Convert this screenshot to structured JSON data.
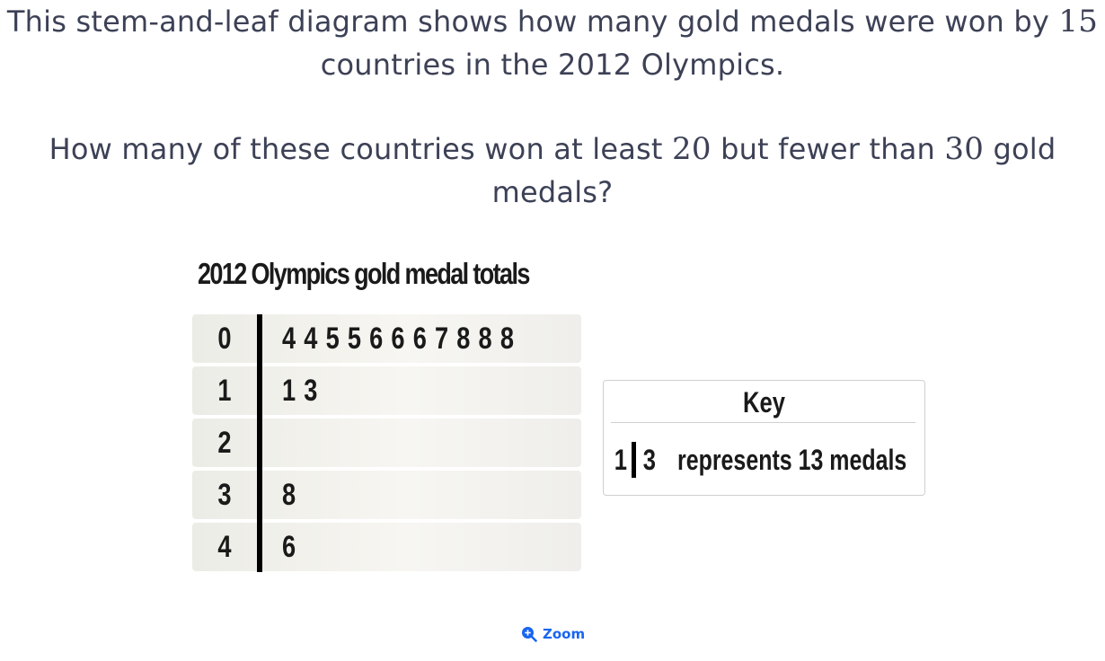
{
  "question": {
    "line1": {
      "before": "This stem-and-leaf diagram shows how many gold medals were won by",
      "num": "15",
      "after": "countries in the 2012 Olympics."
    },
    "line2": {
      "before": "How many of these countries won at least",
      "num1": "20",
      "middle": "but fewer than",
      "num2": "30",
      "after": "gold medals?"
    }
  },
  "plot": {
    "title": "2012 Olympics gold medal totals",
    "rows": [
      {
        "stem": "0",
        "leaves": "4 4 5 5 6 6 6 7 8 8 8"
      },
      {
        "stem": "1",
        "leaves": "1 3"
      },
      {
        "stem": "2",
        "leaves": ""
      },
      {
        "stem": "3",
        "leaves": "8"
      },
      {
        "stem": "4",
        "leaves": "6"
      }
    ]
  },
  "key": {
    "title": "Key",
    "stem": "1",
    "leaf": "3",
    "text": "represents 13 medals"
  },
  "zoom": {
    "label": "Zoom",
    "icon": "zoom-in-icon",
    "color": "#1865f2"
  },
  "colors": {
    "question_text": "#3d4156",
    "plot_text": "#1a1a1a"
  }
}
